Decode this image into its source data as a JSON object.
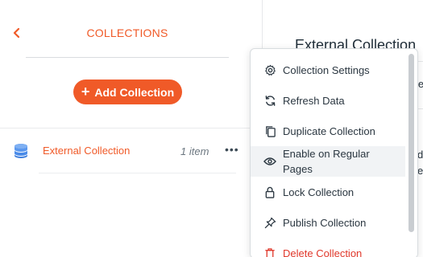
{
  "sidebar": {
    "back_icon": "chevron-left-icon",
    "title": "COLLECTIONS",
    "add_button": {
      "icon": "plus-icon",
      "label": "+ Add Collection",
      "text": "Add Collection"
    },
    "collections": [
      {
        "icon": "database-icon",
        "name": "External Collection",
        "count": "1 item",
        "more_icon": "more-horizontal-icon"
      }
    ]
  },
  "main": {
    "title": "External Collection",
    "snippets": [
      "le",
      "d",
      "e"
    ]
  },
  "context_menu": {
    "items": [
      {
        "icon": "gear-icon",
        "label": "Collection Settings"
      },
      {
        "icon": "refresh-icon",
        "label": "Refresh Data"
      },
      {
        "icon": "duplicate-icon",
        "label": "Duplicate Collection"
      },
      {
        "icon": "eye-icon",
        "label": "Enable on Regular Pages",
        "highlighted": true
      },
      {
        "icon": "lock-icon",
        "label": "Lock Collection"
      },
      {
        "icon": "pin-icon",
        "label": "Publish Collection"
      },
      {
        "icon": "trash-icon",
        "label": "Delete Collection",
        "danger": true
      }
    ]
  },
  "colors": {
    "accent": "#f05a28",
    "danger": "#e0382b",
    "db_icon": "#4a8be8",
    "text": "#2a3640"
  }
}
